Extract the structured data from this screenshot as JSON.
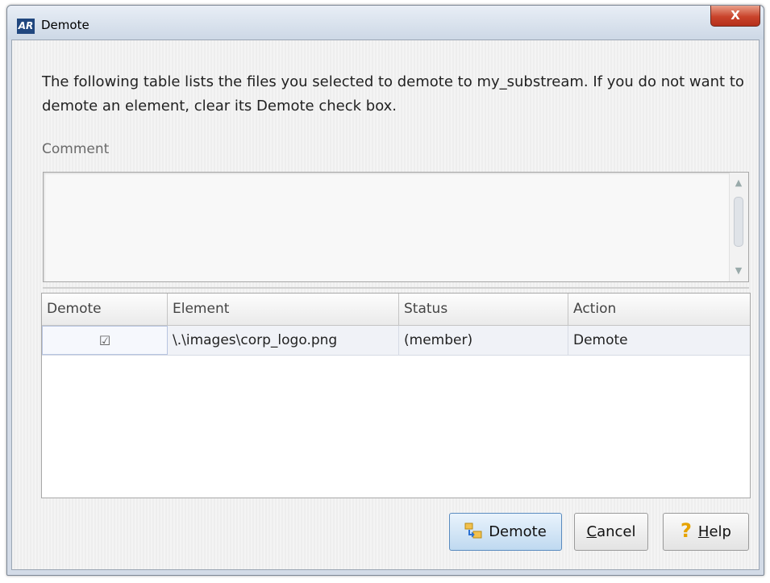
{
  "window": {
    "app_icon_text": "AR",
    "title": "Demote",
    "close_glyph": "X"
  },
  "description": "The following table lists the files you selected to demote to my_substream. If you do not want to demote an element, clear its Demote check box.",
  "comment": {
    "label": "Comment",
    "value": ""
  },
  "table": {
    "columns": [
      "Demote",
      "Element",
      "Status",
      "Action"
    ],
    "rows": [
      {
        "demote_checked": true,
        "element": "\\.\\images\\corp_logo.png",
        "status": "(member)",
        "action": "Demote"
      }
    ]
  },
  "buttons": {
    "demote": {
      "label": "Demote"
    },
    "cancel": {
      "mnemonic": "C",
      "rest": "ancel"
    },
    "help": {
      "mnemonic": "H",
      "rest": "elp"
    }
  },
  "icons": {
    "demote": "demote-icon",
    "help": "question-mark-icon",
    "checkbox": "checkbox-checked-icon"
  }
}
